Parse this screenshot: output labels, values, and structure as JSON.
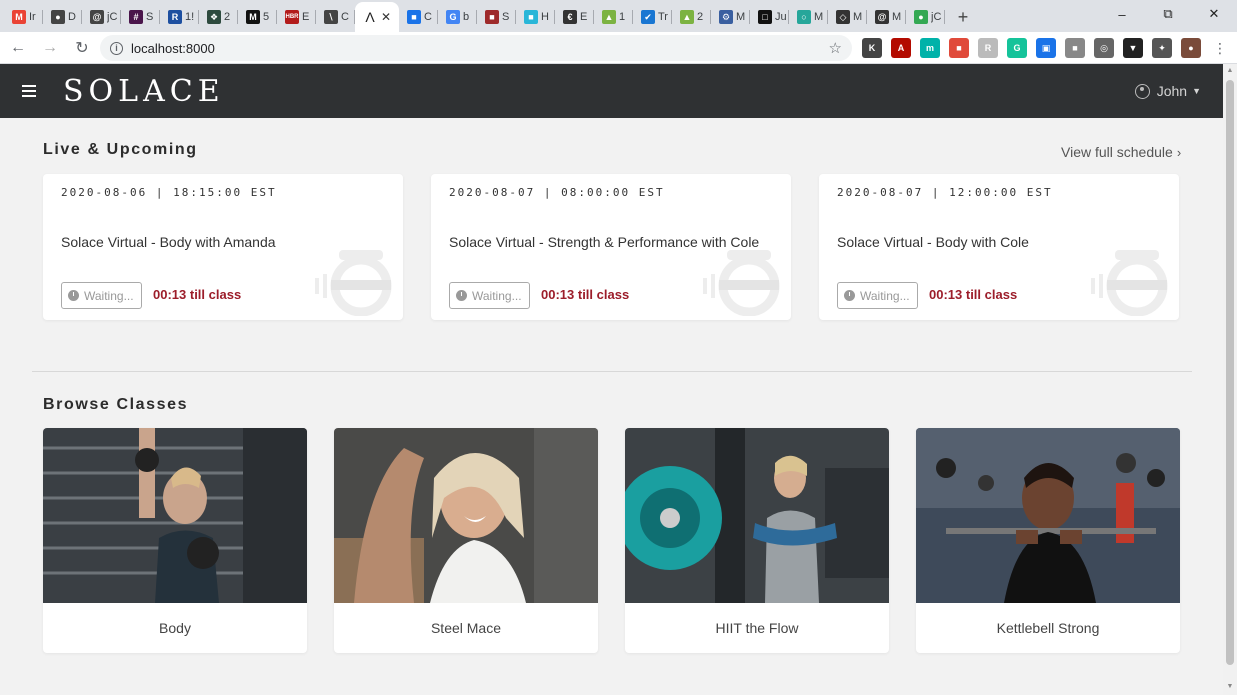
{
  "browser": {
    "tabs": [
      {
        "letter": "M",
        "label": "Ir",
        "color": "#ea4335"
      },
      {
        "letter": "●",
        "label": "D",
        "color": "#444"
      },
      {
        "letter": "@",
        "label": "jC",
        "color": "#444"
      },
      {
        "letter": "#",
        "label": "S",
        "color": "#4a154b"
      },
      {
        "letter": "R",
        "label": "1!",
        "color": "#1d4fa0"
      },
      {
        "letter": "❖",
        "label": "2",
        "color": "#2d4a3e"
      },
      {
        "letter": "M",
        "label": "5",
        "color": "#111"
      },
      {
        "letter": "HBR",
        "label": "E",
        "color": "#b31b1b"
      },
      {
        "letter": "∖",
        "label": "C",
        "color": "#444"
      },
      {
        "letter": "Λ",
        "label": "",
        "color": "#222",
        "active": true
      },
      {
        "letter": "■",
        "label": "C",
        "color": "#1a73e8"
      },
      {
        "letter": "G",
        "label": "b",
        "color": "#4285f4"
      },
      {
        "letter": "■",
        "label": "S",
        "color": "#9e2a2b"
      },
      {
        "letter": "■",
        "label": "H",
        "color": "#29b6d8"
      },
      {
        "letter": "€",
        "label": "E",
        "color": "#333"
      },
      {
        "letter": "▲",
        "label": "1",
        "color": "#7cb342"
      },
      {
        "letter": "✔",
        "label": "Tr",
        "color": "#1976d2"
      },
      {
        "letter": "▲",
        "label": "2",
        "color": "#7cb342"
      },
      {
        "letter": "⚙",
        "label": "M",
        "color": "#3a5fa0"
      },
      {
        "letter": "□",
        "label": "Ju",
        "color": "#111"
      },
      {
        "letter": "○",
        "label": "M",
        "color": "#26a69a"
      },
      {
        "letter": "◇",
        "label": "M",
        "color": "#333"
      },
      {
        "letter": "@",
        "label": "M",
        "color": "#333"
      },
      {
        "letter": "●",
        "label": "jC",
        "color": "#34a853"
      }
    ],
    "window_controls": {
      "minimize": "–",
      "restore": "⧉",
      "close": "✕"
    },
    "url": "localhost:8000",
    "extensions": [
      {
        "letter": "K",
        "color": "#444"
      },
      {
        "letter": "A",
        "color": "#b30b00"
      },
      {
        "letter": "m",
        "color": "#00b2a9"
      },
      {
        "letter": "■",
        "color": "#e04a3a"
      },
      {
        "letter": "R",
        "color": "#bbb"
      },
      {
        "letter": "G",
        "color": "#15c39a"
      },
      {
        "letter": "▣",
        "color": "#1a73e8"
      },
      {
        "letter": "■",
        "color": "#888"
      },
      {
        "letter": "◎",
        "color": "#666"
      },
      {
        "letter": "▼",
        "color": "#222"
      },
      {
        "letter": "✦",
        "color": "#555"
      },
      {
        "letter": "●",
        "color": "#7a4b3a"
      }
    ]
  },
  "app": {
    "logo": "SOLACE",
    "user": "John"
  },
  "live": {
    "title": "Live & Upcoming",
    "view_schedule": "View full schedule",
    "cards": [
      {
        "datetime": "2020-08-06 | 18:15:00 EST",
        "name": "Solace Virtual - Body with Amanda",
        "status": "Waiting...",
        "countdown": "00:13 till class"
      },
      {
        "datetime": "2020-08-07 | 08:00:00 EST",
        "name": "Solace Virtual - Strength & Performance with Cole",
        "status": "Waiting...",
        "countdown": "00:13 till class"
      },
      {
        "datetime": "2020-08-07 | 12:00:00 EST",
        "name": "Solace Virtual - Body with Cole",
        "status": "Waiting...",
        "countdown": "00:13 till class"
      }
    ]
  },
  "browse": {
    "title": "Browse Classes",
    "classes": [
      {
        "name": "Body"
      },
      {
        "name": "Steel Mace"
      },
      {
        "name": "HIIT the Flow"
      },
      {
        "name": "Kettlebell Strong"
      }
    ]
  },
  "colors": {
    "navbar": "#2f3133",
    "countdown": "#9c1d2a",
    "background": "#f2f2f2"
  }
}
